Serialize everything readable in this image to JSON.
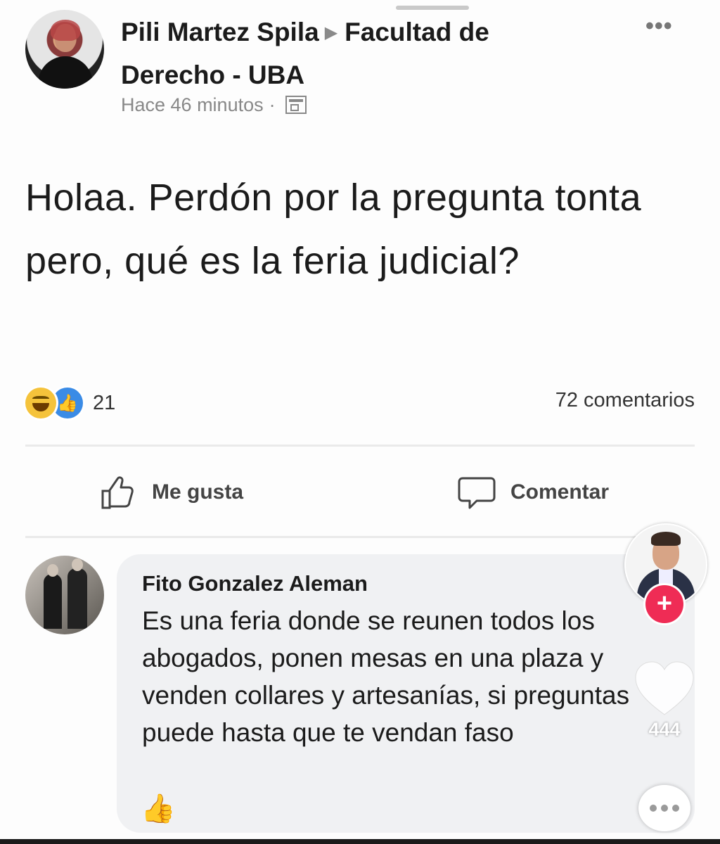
{
  "post": {
    "author": "Pili Martez Spila",
    "group": "Facultad de Derecho - UBA",
    "time": "Hace 46 minutos",
    "text": "Holaa. Perdón por la pregunta tonta pero, qué es la feria judicial?",
    "reaction_count": "21",
    "comments_count": "72 comentarios",
    "actions": {
      "like_label": "Me gusta",
      "comment_label": "Comentar"
    }
  },
  "comment": {
    "author": "Fito Gonzalez Aleman",
    "text": "Es una feria donde se reunen todos los abogados, ponen mesas en una plaza y venden collares y artesanías, si preguntas puede hasta que te vendan faso"
  },
  "overlay": {
    "like_count": "444",
    "follow_symbol": "+"
  },
  "icons": {
    "reactions": [
      "haha-reaction-icon",
      "like-reaction-icon"
    ],
    "more": "more-options-icon",
    "audience": "group-page-icon",
    "like": "thumbs-up-outline-icon",
    "comment": "speech-bubble-icon",
    "heart": "heart-icon",
    "comments_overlay": "ellipsis-bubble-icon"
  },
  "colors": {
    "follow": "#ef2c55",
    "like_reaction": "#3a8be6",
    "haha_reaction": "#f5c33b"
  }
}
